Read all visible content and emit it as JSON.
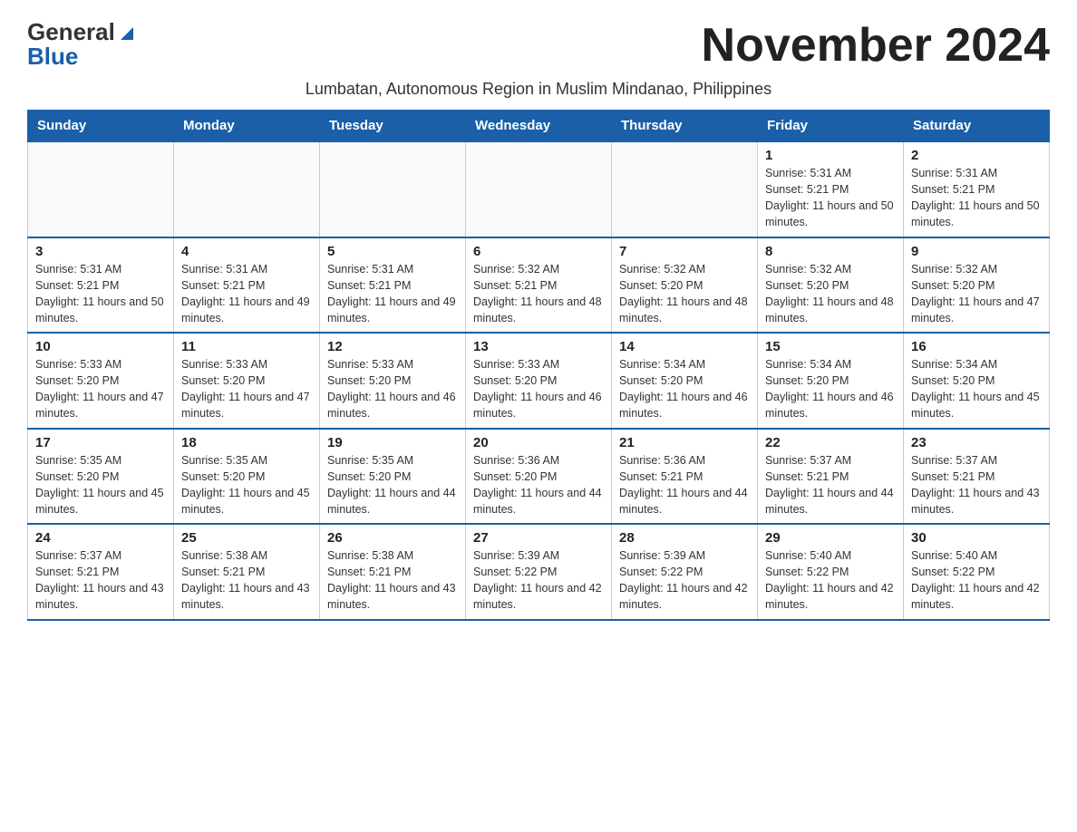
{
  "header": {
    "logo_line1": "General",
    "logo_line2": "Blue",
    "month_title": "November 2024",
    "subtitle": "Lumbatan, Autonomous Region in Muslim Mindanao, Philippines"
  },
  "calendar": {
    "days_of_week": [
      "Sunday",
      "Monday",
      "Tuesday",
      "Wednesday",
      "Thursday",
      "Friday",
      "Saturday"
    ],
    "weeks": [
      [
        {
          "day": "",
          "sunrise": "",
          "sunset": "",
          "daylight": ""
        },
        {
          "day": "",
          "sunrise": "",
          "sunset": "",
          "daylight": ""
        },
        {
          "day": "",
          "sunrise": "",
          "sunset": "",
          "daylight": ""
        },
        {
          "day": "",
          "sunrise": "",
          "sunset": "",
          "daylight": ""
        },
        {
          "day": "",
          "sunrise": "",
          "sunset": "",
          "daylight": ""
        },
        {
          "day": "1",
          "sunrise": "Sunrise: 5:31 AM",
          "sunset": "Sunset: 5:21 PM",
          "daylight": "Daylight: 11 hours and 50 minutes."
        },
        {
          "day": "2",
          "sunrise": "Sunrise: 5:31 AM",
          "sunset": "Sunset: 5:21 PM",
          "daylight": "Daylight: 11 hours and 50 minutes."
        }
      ],
      [
        {
          "day": "3",
          "sunrise": "Sunrise: 5:31 AM",
          "sunset": "Sunset: 5:21 PM",
          "daylight": "Daylight: 11 hours and 50 minutes."
        },
        {
          "day": "4",
          "sunrise": "Sunrise: 5:31 AM",
          "sunset": "Sunset: 5:21 PM",
          "daylight": "Daylight: 11 hours and 49 minutes."
        },
        {
          "day": "5",
          "sunrise": "Sunrise: 5:31 AM",
          "sunset": "Sunset: 5:21 PM",
          "daylight": "Daylight: 11 hours and 49 minutes."
        },
        {
          "day": "6",
          "sunrise": "Sunrise: 5:32 AM",
          "sunset": "Sunset: 5:21 PM",
          "daylight": "Daylight: 11 hours and 48 minutes."
        },
        {
          "day": "7",
          "sunrise": "Sunrise: 5:32 AM",
          "sunset": "Sunset: 5:20 PM",
          "daylight": "Daylight: 11 hours and 48 minutes."
        },
        {
          "day": "8",
          "sunrise": "Sunrise: 5:32 AM",
          "sunset": "Sunset: 5:20 PM",
          "daylight": "Daylight: 11 hours and 48 minutes."
        },
        {
          "day": "9",
          "sunrise": "Sunrise: 5:32 AM",
          "sunset": "Sunset: 5:20 PM",
          "daylight": "Daylight: 11 hours and 47 minutes."
        }
      ],
      [
        {
          "day": "10",
          "sunrise": "Sunrise: 5:33 AM",
          "sunset": "Sunset: 5:20 PM",
          "daylight": "Daylight: 11 hours and 47 minutes."
        },
        {
          "day": "11",
          "sunrise": "Sunrise: 5:33 AM",
          "sunset": "Sunset: 5:20 PM",
          "daylight": "Daylight: 11 hours and 47 minutes."
        },
        {
          "day": "12",
          "sunrise": "Sunrise: 5:33 AM",
          "sunset": "Sunset: 5:20 PM",
          "daylight": "Daylight: 11 hours and 46 minutes."
        },
        {
          "day": "13",
          "sunrise": "Sunrise: 5:33 AM",
          "sunset": "Sunset: 5:20 PM",
          "daylight": "Daylight: 11 hours and 46 minutes."
        },
        {
          "day": "14",
          "sunrise": "Sunrise: 5:34 AM",
          "sunset": "Sunset: 5:20 PM",
          "daylight": "Daylight: 11 hours and 46 minutes."
        },
        {
          "day": "15",
          "sunrise": "Sunrise: 5:34 AM",
          "sunset": "Sunset: 5:20 PM",
          "daylight": "Daylight: 11 hours and 46 minutes."
        },
        {
          "day": "16",
          "sunrise": "Sunrise: 5:34 AM",
          "sunset": "Sunset: 5:20 PM",
          "daylight": "Daylight: 11 hours and 45 minutes."
        }
      ],
      [
        {
          "day": "17",
          "sunrise": "Sunrise: 5:35 AM",
          "sunset": "Sunset: 5:20 PM",
          "daylight": "Daylight: 11 hours and 45 minutes."
        },
        {
          "day": "18",
          "sunrise": "Sunrise: 5:35 AM",
          "sunset": "Sunset: 5:20 PM",
          "daylight": "Daylight: 11 hours and 45 minutes."
        },
        {
          "day": "19",
          "sunrise": "Sunrise: 5:35 AM",
          "sunset": "Sunset: 5:20 PM",
          "daylight": "Daylight: 11 hours and 44 minutes."
        },
        {
          "day": "20",
          "sunrise": "Sunrise: 5:36 AM",
          "sunset": "Sunset: 5:20 PM",
          "daylight": "Daylight: 11 hours and 44 minutes."
        },
        {
          "day": "21",
          "sunrise": "Sunrise: 5:36 AM",
          "sunset": "Sunset: 5:21 PM",
          "daylight": "Daylight: 11 hours and 44 minutes."
        },
        {
          "day": "22",
          "sunrise": "Sunrise: 5:37 AM",
          "sunset": "Sunset: 5:21 PM",
          "daylight": "Daylight: 11 hours and 44 minutes."
        },
        {
          "day": "23",
          "sunrise": "Sunrise: 5:37 AM",
          "sunset": "Sunset: 5:21 PM",
          "daylight": "Daylight: 11 hours and 43 minutes."
        }
      ],
      [
        {
          "day": "24",
          "sunrise": "Sunrise: 5:37 AM",
          "sunset": "Sunset: 5:21 PM",
          "daylight": "Daylight: 11 hours and 43 minutes."
        },
        {
          "day": "25",
          "sunrise": "Sunrise: 5:38 AM",
          "sunset": "Sunset: 5:21 PM",
          "daylight": "Daylight: 11 hours and 43 minutes."
        },
        {
          "day": "26",
          "sunrise": "Sunrise: 5:38 AM",
          "sunset": "Sunset: 5:21 PM",
          "daylight": "Daylight: 11 hours and 43 minutes."
        },
        {
          "day": "27",
          "sunrise": "Sunrise: 5:39 AM",
          "sunset": "Sunset: 5:22 PM",
          "daylight": "Daylight: 11 hours and 42 minutes."
        },
        {
          "day": "28",
          "sunrise": "Sunrise: 5:39 AM",
          "sunset": "Sunset: 5:22 PM",
          "daylight": "Daylight: 11 hours and 42 minutes."
        },
        {
          "day": "29",
          "sunrise": "Sunrise: 5:40 AM",
          "sunset": "Sunset: 5:22 PM",
          "daylight": "Daylight: 11 hours and 42 minutes."
        },
        {
          "day": "30",
          "sunrise": "Sunrise: 5:40 AM",
          "sunset": "Sunset: 5:22 PM",
          "daylight": "Daylight: 11 hours and 42 minutes."
        }
      ]
    ]
  }
}
